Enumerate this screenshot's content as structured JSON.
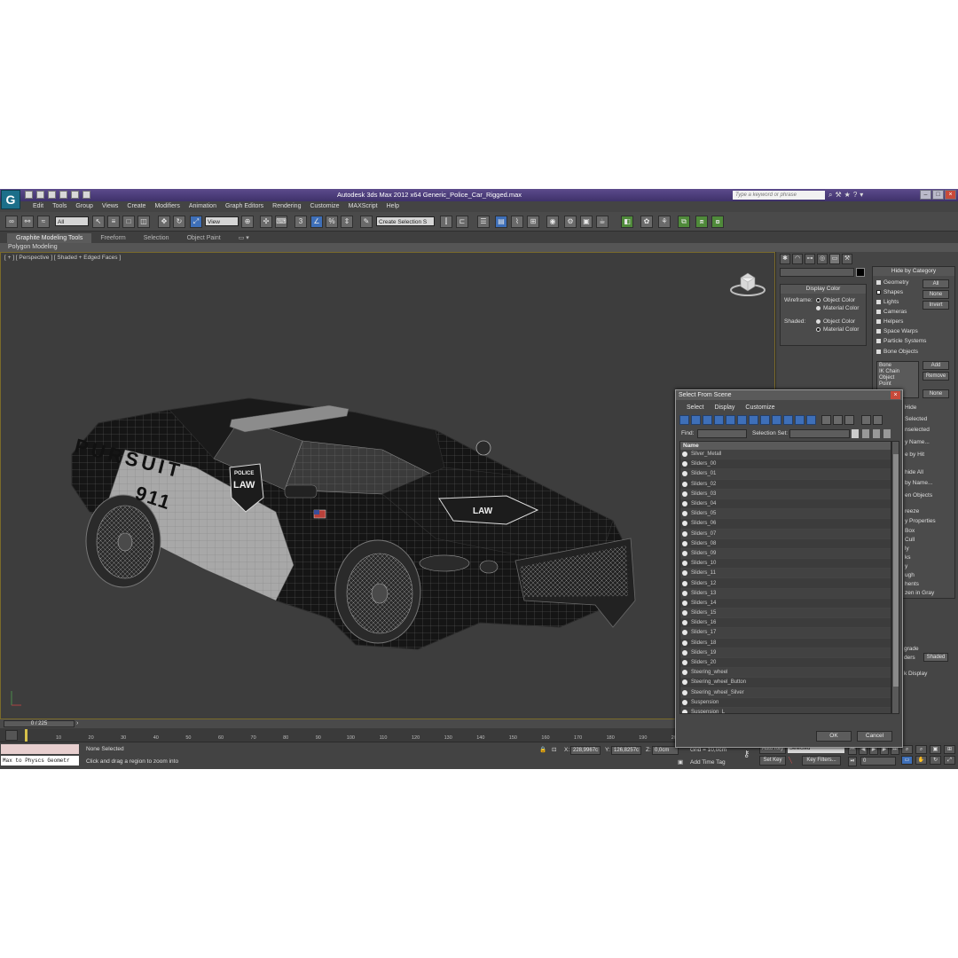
{
  "app": {
    "title": "Autodesk 3ds Max  2012 x64    Generic_Police_Car_Rigged.max",
    "search_placeholder": "Type a keyword or phrase"
  },
  "menu": [
    "Edit",
    "Tools",
    "Group",
    "Views",
    "Create",
    "Modifiers",
    "Animation",
    "Graph Editors",
    "Rendering",
    "Customize",
    "MAXScript",
    "Help"
  ],
  "toolbar": {
    "filter_value": "All",
    "ref_coord_value": "View",
    "named_sel_value": "Create Selection S"
  },
  "ribbon": {
    "tabs": [
      "Graphite Modeling Tools",
      "Freeform",
      "Selection",
      "Object Paint"
    ],
    "sub_label": "Polygon Modeling"
  },
  "viewport": {
    "label": "[ + ] [ Perspective ] [ Shaded + Edged Faces ]",
    "car_text": {
      "side": "PURSUIT",
      "number": "911",
      "badge_top": "POLICE",
      "badge_main": "LAW"
    }
  },
  "timeline": {
    "slider_label": "0 / 225",
    "ticks": [
      "10",
      "20",
      "30",
      "40",
      "50",
      "60",
      "70",
      "80",
      "90",
      "100",
      "110",
      "120",
      "130",
      "140",
      "150",
      "160",
      "170",
      "180",
      "190",
      "200"
    ]
  },
  "status": {
    "maxscript_text": "Max to Physcs Geometr",
    "selection": "None Selected",
    "prompt": "Click and drag a region to zoom into",
    "x_label": "X:",
    "x_value": "228,9967c",
    "y_label": "Y:",
    "y_value": "126,8257c",
    "z_label": "Z:",
    "z_value": "0,0cm",
    "grid": "Grid = 10,0cm",
    "add_time_tag": "Add Time Tag",
    "auto_key": "Auto Key",
    "set_key": "Set Key",
    "selected_value": "Selected",
    "key_filters": "Key Filters...",
    "frame_value": "0"
  },
  "command_panel": {
    "display_color": {
      "header": "Display Color",
      "wireframe_label": "Wireframe:",
      "shaded_label": "Shaded:",
      "object_color": "Object Color",
      "material_color": "Material Color"
    },
    "hide_by_category": {
      "header": "Hide by Category",
      "items": [
        "Geometry",
        "Shapes",
        "Lights",
        "Cameras",
        "Helpers",
        "Space Warps",
        "Particle Systems",
        "Bone Objects"
      ],
      "btn_all": "All",
      "btn_none": "None",
      "btn_invert": "Invert",
      "list": [
        "Bone",
        "IK Chain Object",
        "Point"
      ],
      "btn_add": "Add",
      "btn_remove": "Remove",
      "btn_none2": "None"
    },
    "partial": [
      "Hide",
      "Selected",
      "nselected",
      "y Name...",
      "e by Hit",
      "hide All",
      "by Name...",
      "en Objects",
      "reeze",
      "y Properties",
      "Box",
      "Cull",
      "ly",
      "ks",
      "y",
      "ugh",
      "hents",
      "zen in Gray",
      "grade",
      "ders",
      "k Display"
    ],
    "shaded_btn": "Shaded"
  },
  "dialog": {
    "title": "Select From Scene",
    "menu": [
      "Select",
      "Display",
      "Customize"
    ],
    "find_label": "Find:",
    "selection_set_label": "Selection Set:",
    "column_name": "Name",
    "items": [
      "Silver_Metall",
      "Sliders_00",
      "Sliders_01",
      "Sliders_02",
      "Sliders_03",
      "Sliders_04",
      "Sliders_05",
      "Sliders_06",
      "Sliders_07",
      "Sliders_08",
      "Sliders_09",
      "Sliders_10",
      "Sliders_11",
      "Sliders_12",
      "Sliders_13",
      "Sliders_14",
      "Sliders_15",
      "Sliders_16",
      "Sliders_17",
      "Sliders_18",
      "Sliders_19",
      "Sliders_20",
      "Steering_wheel",
      "Steering_wheel_Button",
      "Steering_wheel_Silver",
      "Suspension",
      "Suspension_L"
    ],
    "ok": "OK",
    "cancel": "Cancel"
  },
  "colors": {
    "titlebar": "#4a3c7c",
    "viewport_bg": "#3d3d3d",
    "accent_blue": "#3e6fb8",
    "car_body": "#141414",
    "car_panel": "#a9a9a9"
  }
}
